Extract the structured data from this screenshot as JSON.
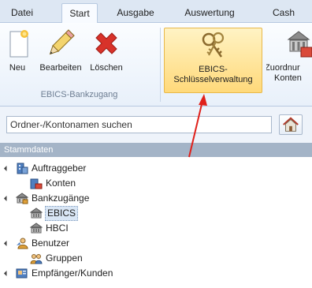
{
  "tabs": [
    {
      "label": "Datei"
    },
    {
      "label": "Start",
      "active": true
    },
    {
      "label": "Ausgabe"
    },
    {
      "label": "Auswertung"
    },
    {
      "label": "Cash"
    }
  ],
  "ribbon": {
    "buttons": {
      "neu": {
        "label": "Neu",
        "icon": "new-document-icon"
      },
      "bearbeiten": {
        "label": "Bearbeiten",
        "icon": "pencil-icon"
      },
      "loeschen": {
        "label": "Löschen",
        "icon": "delete-x-icon"
      },
      "ebics_line1": "EBICS-",
      "ebics_line2": "Schlüsselverwaltung",
      "zuordnung_line1": "Zuordnur",
      "zuordnung_line2": "Konten"
    },
    "group_label": "EBICS-Bankzugang"
  },
  "search": {
    "placeholder": "Ordner-/Kontonamen suchen",
    "value": ""
  },
  "section_header": "Stammdaten",
  "tree": [
    {
      "label": "Auftraggeber",
      "icon": "client-icon"
    },
    {
      "label": "Konten",
      "icon": "accounts-icon"
    },
    {
      "label": "Bankzugänge",
      "icon": "bank-icon"
    },
    {
      "label": "EBICS",
      "icon": "bank-access-icon",
      "selected": true
    },
    {
      "label": "HBCI",
      "icon": "bank-access-icon"
    },
    {
      "label": "Benutzer",
      "icon": "user-icon"
    },
    {
      "label": "Gruppen",
      "icon": "group-icon"
    },
    {
      "label": "Empfänger/Kunden",
      "icon": "recipient-icon"
    }
  ],
  "colors": {
    "accent_highlight": "#ffd97a",
    "annotation_arrow": "#e0201a"
  }
}
